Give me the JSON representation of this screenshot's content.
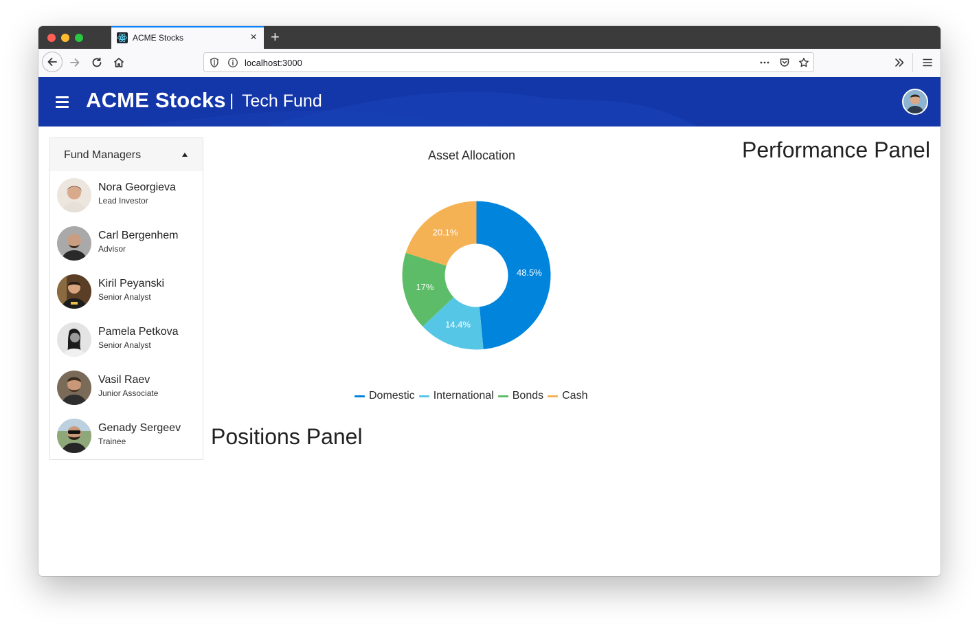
{
  "browser": {
    "tab_title": "ACME Stocks",
    "url": "localhost:3000"
  },
  "header": {
    "brand": "ACME Stocks",
    "separator": "|",
    "fund": "Tech Fund"
  },
  "sidebar": {
    "title": "Fund Managers",
    "managers": [
      {
        "name": "Nora Georgieva",
        "role": "Lead Investor",
        "color": "#c9a27e"
      },
      {
        "name": "Carl Bergenhem",
        "role": "Advisor",
        "color": "#5a5a5a"
      },
      {
        "name": "Kiril Peyanski",
        "role": "Senior Analyst",
        "color": "#7a5a3a"
      },
      {
        "name": "Pamela Petkova",
        "role": "Senior Analyst",
        "color": "#cfcfcf"
      },
      {
        "name": "Vasil Raev",
        "role": "Junior Associate",
        "color": "#6b5a4a"
      },
      {
        "name": "Genady Sergeev",
        "role": "Trainee",
        "color": "#6f8a5a"
      }
    ]
  },
  "panels": {
    "performance": "Performance Panel",
    "positions": "Positions Panel"
  },
  "chart_data": {
    "type": "pie",
    "title": "Asset Allocation",
    "donut": true,
    "legend_position": "bottom",
    "categories": [
      "Domestic",
      "International",
      "Bonds",
      "Cash"
    ],
    "values": [
      48.5,
      14.4,
      17,
      20.1
    ],
    "labels": [
      "48.5%",
      "14.4%",
      "17%",
      "20.1%"
    ],
    "colors": [
      "#0084dc",
      "#56c6e6",
      "#5cbc67",
      "#f5b254"
    ]
  }
}
